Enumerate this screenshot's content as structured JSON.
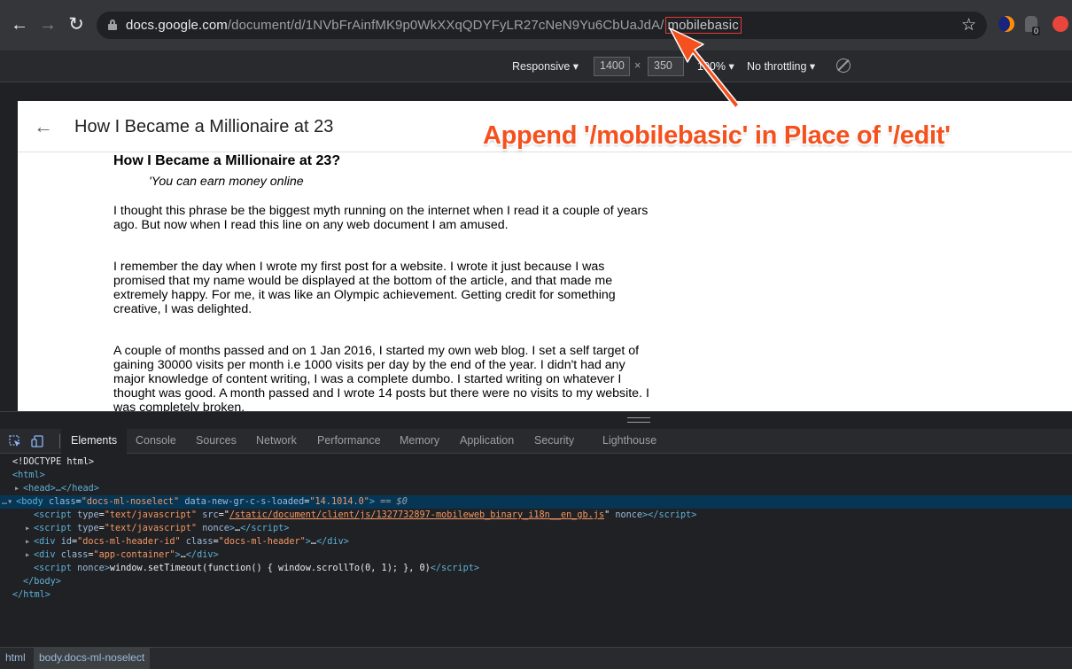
{
  "browser": {
    "url_host": "docs.google.com",
    "url_path": "/document/d/1NVbFrAinfMK9p0WkXXqQDYFyLR27cNeN9Yu6CbUaJdA/",
    "url_highlight": "mobilebasic",
    "ext_badge": "0"
  },
  "device_toolbar": {
    "device": "Responsive ▾",
    "width": "1400",
    "times": "×",
    "height": "350",
    "zoom": "100% ▾",
    "throttle": "No throttling ▾"
  },
  "annotation": {
    "text": "Append '/mobilebasic' in Place of '/edit'",
    "color": "#f4511e"
  },
  "doc": {
    "header_title": "How I Became a Millionaire at 23",
    "heading": "How I Became a Millionaire at 23?",
    "quote": "'You can earn money online",
    "paragraphs": [
      "I thought this phrase be the biggest myth running on the internet when I read it a couple of years ago. But now when I read this line on any web document I am amused.",
      "I remember the day when I wrote my first post for a website. I wrote it just because I was promised that my name would be displayed at the bottom of the article, and that made me extremely happy. For me, it was like an Olympic achievement. Getting credit for something creative, I was delighted.",
      "A couple of months passed and on 1 Jan 2016, I started my own web blog. I set a self target of gaining 30000 visits per month i.e 1000 visits per day by the end of the year. I didn't had any major knowledge of content writing, I was a complete dumbo. I started writing on whatever I thought was good. A month passed and I wrote 14 posts but there were no visits to my website. I was completely broken."
    ]
  },
  "devtools": {
    "tabs": [
      "Elements",
      "Console",
      "Sources",
      "Network",
      "Performance",
      "Memory",
      "Application",
      "Security",
      "Lighthouse"
    ],
    "active_tab": "Elements",
    "dom": {
      "doctype": "<!DOCTYPE html>",
      "html_open": "<html>",
      "head": "<head>…</head>",
      "body_tag": "body",
      "body_class_attr": "class",
      "body_class_val": "\"docs-ml-noselect\"",
      "body_data_attr": "data-new-gr-c-s-loaded",
      "body_data_val": "\"14.1014.0\"",
      "body_eq": "== $0",
      "script1_type_val": "\"text/javascript\"",
      "script1_src_val": "/static/document/client/js/1327732897-mobileweb_binary_i18n__en_gb.js",
      "script2_type_val": "\"text/javascript\"",
      "div1_id_val": "\"docs-ml-header-id\"",
      "div1_class_val": "\"docs-ml-header\"",
      "div2_class_val": "\"app-container\"",
      "script3_text": "window.setTimeout(function() { window.scrollTo(0, 1); }, 0)",
      "body_close": "</body>",
      "html_close": "</html>"
    },
    "breadcrumbs": [
      "html",
      "body.docs-ml-noselect"
    ]
  }
}
